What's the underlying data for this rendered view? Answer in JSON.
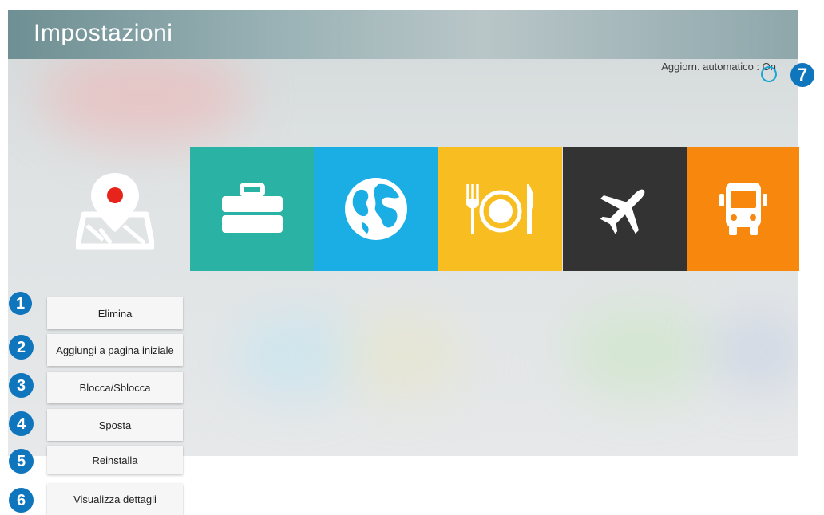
{
  "header": {
    "title": "Impostazioni"
  },
  "auto_update": {
    "label": "Aggiorn. automatico : On"
  },
  "tiles": [
    {
      "icon": "map-pin-icon",
      "color": "#e6241b"
    },
    {
      "icon": "briefcase-icon",
      "color": "#2ab3a4"
    },
    {
      "icon": "globe-icon",
      "color": "#1aaee5"
    },
    {
      "icon": "dining-icon",
      "color": "#f7bd21"
    },
    {
      "icon": "airplane-icon",
      "color": "#333333"
    },
    {
      "icon": "bus-icon",
      "color": "#f7870d"
    }
  ],
  "menu": [
    {
      "badge": "1",
      "label": "Elimina"
    },
    {
      "badge": "2",
      "label": "Aggiungi a pagina iniziale"
    },
    {
      "badge": "3",
      "label": "Blocca/Sblocca"
    },
    {
      "badge": "4",
      "label": "Sposta"
    },
    {
      "badge": "5",
      "label": "Reinstalla"
    },
    {
      "badge": "6",
      "label": "Visualizza dettagli"
    }
  ],
  "callout_7": "7"
}
